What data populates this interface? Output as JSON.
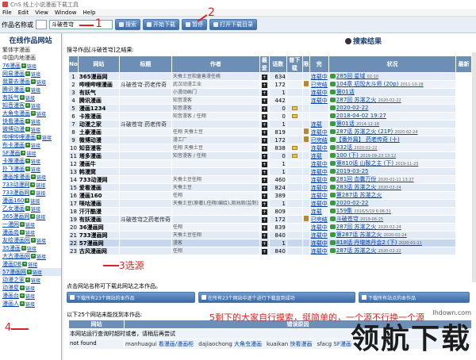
{
  "window": {
    "title": "CnS 线上小说漫画下载工具"
  },
  "menu": [
    "File",
    "Edit",
    "View",
    "Window",
    "Help"
  ],
  "toolbar": {
    "label": "作品名称或",
    "search_value": "斗破苍穹",
    "btn_search": "搜索",
    "btn_download": "开始下载",
    "btn_stop": "暂停",
    "btn_open": "打开下载目录"
  },
  "annotations": {
    "n1": "1",
    "n2": "2",
    "n3": "3选源",
    "n4": "4",
    "n5": "5剩下的大家自行摸索，挺简单的，一个源不行换一个源"
  },
  "sidebar": {
    "title": "在线作品网站",
    "link_label": "链接",
    "items": [
      {
        "name": "繁体字漫画",
        "plain": true
      },
      {
        "name": "中国内地漫画",
        "plain": true
      },
      {
        "name": "76漫画"
      },
      {
        "name": "网易漫画"
      },
      {
        "name": "我要去漫画"
      },
      {
        "name": "腾讯漫画"
      },
      {
        "name": "有妖气"
      },
      {
        "name": "知音漫客"
      },
      {
        "name": "大角虫漫画"
      },
      {
        "name": "快看漫画"
      },
      {
        "name": "微博动漫"
      },
      {
        "name": "哔哩哔哩漫画"
      },
      {
        "name": "布卡漫画"
      },
      {
        "name": "SF漫画"
      },
      {
        "name": "卡推漫画"
      },
      {
        "name": "扑飞漫画"
      },
      {
        "name": "漫画堆漫画"
      },
      {
        "name": "733动漫网"
      },
      {
        "name": "733漫画网"
      },
      {
        "name": "漫画160"
      },
      {
        "name": "乙女漫画"
      },
      {
        "name": "365漫画网"
      },
      {
        "name": "一漫网"
      },
      {
        "name": "漫画岛"
      },
      {
        "name": "友绘漫画网"
      },
      {
        "name": "35漫画"
      },
      {
        "name": "大古漫画网"
      },
      {
        "name": "漫画DB"
      },
      {
        "name": "57漫画网"
      },
      {
        "name": "动漫之家"
      },
      {
        "name": "动漫屋"
      },
      {
        "name": "漫画台"
      },
      {
        "name": "漫画人"
      }
    ]
  },
  "results": {
    "heading": "搜索结果",
    "summary": "搜寻作品[斗破苍穹]之结果:",
    "columns": [
      "No",
      "网站",
      "标题",
      "作者",
      "最爱",
      "话数",
      "普下载",
      "限",
      "完",
      "状况",
      "最新"
    ],
    "rows": [
      {
        "no": "1",
        "site": "365漫画网",
        "title": "",
        "author": "天蚕土豆和童善漫任務",
        "cnt": "634",
        "book": false,
        "lim": false,
        "status": "连载中",
        "latest": "285回 星域",
        "date": "02-10"
      },
      {
        "no": "2",
        "site": "哔哩哔哩漫画",
        "title": "斗破苍穹·药老传奇",
        "author": "武汉动漫工业",
        "cnt": "172",
        "book": false,
        "lim": true,
        "status": "已完结",
        "latest": "104章 初现大斗师 (20p)",
        "date": "2011-10-28"
      },
      {
        "no": "3",
        "site": "有妖气",
        "title": "",
        "author": "小漫动画门",
        "cnt": "1",
        "book": false,
        "lim": false,
        "status": "连载中",
        "latest": "第01话",
        "date": ""
      },
      {
        "no": "4",
        "site": "腾讯漫画",
        "title": "",
        "author": "知音漫客",
        "cnt": "442",
        "book": false,
        "lim": false,
        "status": "连载中",
        "latest": "287回 苏湛之火",
        "date": "2020-02-22"
      },
      {
        "no": "5",
        "site": "漫画1234",
        "title": "",
        "author": "知音漫客",
        "cnt": "0",
        "book": true,
        "lim": false,
        "status": "",
        "latest": "2020-02-22",
        "date": ""
      },
      {
        "no": "6",
        "site": "卡推漫画",
        "title": "",
        "author": "知音漫客 / 任翔",
        "cnt": "0",
        "book": true,
        "lim": false,
        "status": "",
        "latest": "2018-04-02 19:27",
        "date": ""
      },
      {
        "no": "7",
        "site": "动漫之家",
        "title": "斗破苍穹 药老传奇",
        "author": "",
        "cnt": "1",
        "book": false,
        "lim": false,
        "status": "连载",
        "latest": "第01话",
        "date": "2014-12-18"
      },
      {
        "no": "8",
        "site": "土豪漫画",
        "title": "",
        "author": "任翔 天蚕土豆",
        "cnt": "819",
        "book": false,
        "lim": true,
        "status": "连载中",
        "latest": "287话 苏湛之火 (21P)",
        "date": "2020-02-24"
      },
      {
        "no": "9",
        "site": "微博动漫",
        "title": "",
        "author": "漫工厂",
        "cnt": "172",
        "book": false,
        "lim": true,
        "status": "已完结",
        "latest": "【番外篇】 药老传奇 (十)",
        "date": ""
      },
      {
        "no": "10",
        "site": "知音漫客",
        "title": "",
        "author": "任翔 天蚕土豆",
        "cnt": "838",
        "book": true,
        "lim": false,
        "status": "连载中",
        "latest": "832话",
        "date": "2020-02-22"
      },
      {
        "no": "11",
        "site": "塔多漫画",
        "title": "",
        "author": "知音漫客 / 任翔",
        "cnt": "0",
        "book": true,
        "lim": false,
        "status": "连载",
        "latest": "100 (下)",
        "date": "2019-09-23 13:12"
      },
      {
        "no": "12",
        "site": "漫画牛",
        "title": "",
        "author": "",
        "cnt": "1",
        "book": false,
        "lim": false,
        "status": "连载中",
        "latest": "第810话 山鞍之主 (下)",
        "date": "2019-11-23"
      },
      {
        "no": "13",
        "site": "韩漫窝",
        "title": "",
        "author": "",
        "cnt": "1",
        "book": false,
        "lim": false,
        "status": "连载中",
        "latest": "2019-03-25",
        "date": ""
      },
      {
        "no": "14",
        "site": "733动漫网",
        "title": "",
        "author": "天蚕土豆任翔",
        "cnt": "460",
        "book": false,
        "lim": false,
        "status": "连载中",
        "latest": "281回 血囊万份",
        "date": "2020-01-11 13:37"
      },
      {
        "no": "15",
        "site": "爱看漫画",
        "title": "",
        "author": "天蚕土豆",
        "cnt": "824",
        "book": false,
        "lim": false,
        "status": "连载中",
        "latest": "283话 苏湛之火",
        "date": "2020-02-24"
      },
      {
        "no": "16",
        "site": "漫画160",
        "title": "",
        "author": "任翔",
        "cnt": "389",
        "book": false,
        "lim": false,
        "status": "连载中",
        "latest": "第287话 苏湛之火",
        "date": ""
      },
      {
        "no": "17",
        "site": "咪咕漫画",
        "title": "",
        "author": "天蚕土豆(原著),任翔(编绘),周洲周(监制)",
        "cnt": "1",
        "book": false,
        "lim": false,
        "status": "连载中",
        "latest": "2020-02-22",
        "date": ""
      },
      {
        "no": "18",
        "site": "汗汗酷漫",
        "title": "",
        "author": "",
        "cnt": "809",
        "book": false,
        "lim": false,
        "status": "连载",
        "latest": "159集",
        "date": "2016/5/19 6:06:31"
      },
      {
        "no": "19",
        "site": "有妖漫画",
        "title": "斗破苍穹之药老传奇",
        "author": "",
        "cnt": "172",
        "book": false,
        "lim": true,
        "status": "已完结",
        "latest": "斗破苍穹",
        "date": "2019-06-25"
      },
      {
        "no": "20",
        "site": "36漫画网",
        "title": "",
        "author": "任翔",
        "cnt": "839",
        "book": false,
        "lim": false,
        "status": "连载中",
        "latest": "287回 苏湛之火",
        "date": "2020-02-24"
      },
      {
        "no": "21",
        "site": "733漫画网",
        "title": "",
        "author": "天蚕土豆任翔",
        "cnt": "840",
        "book": false,
        "lim": false,
        "status": "连载中",
        "latest": "第287话 苏湛之火",
        "date": "2020-02-24"
      },
      {
        "no": "22",
        "site": "57漫画网",
        "title": "",
        "author": "漫客",
        "cnt": "1",
        "book": false,
        "lim": false,
        "status": "连载中",
        "latest": "818话 丹堪炼丹会2 (下)",
        "date": "2020-01-11"
      },
      {
        "no": "23",
        "site": "古风漫画网",
        "title": "",
        "author": "任翔",
        "cnt": "840",
        "book": false,
        "lim": false,
        "status": "连载中",
        "latest": "287话 苏湛之火",
        "date": "2020-02-22"
      }
    ]
  },
  "hint": "点击网站名称可下载此网站之本作品。",
  "big_buttons": {
    "b1": "下载所有23个网站的本作品",
    "b2": "在所有23个网站中逐个进行下载直到成功",
    "b3": "下载所有站点的本作品"
  },
  "notfound": {
    "title": "以下25个网站未能找到本作品:",
    "columns": [
      "网站",
      "错误原因"
    ],
    "reason": "本网站运行查询时超时或者，请稍后再尝试",
    "label": "not found",
    "items": [
      {
        "site": "manhuagui",
        "title": "看漫画/漫画柜"
      },
      {
        "site": "dajiaochong",
        "title": "大角虫漫画"
      },
      {
        "site": "kuaikan",
        "title": "快看漫画"
      },
      {
        "site": "sfacg",
        "title": "SF漫画"
      }
    ]
  },
  "watermark": {
    "text": "领航下载",
    "url": "lhdown.com"
  }
}
